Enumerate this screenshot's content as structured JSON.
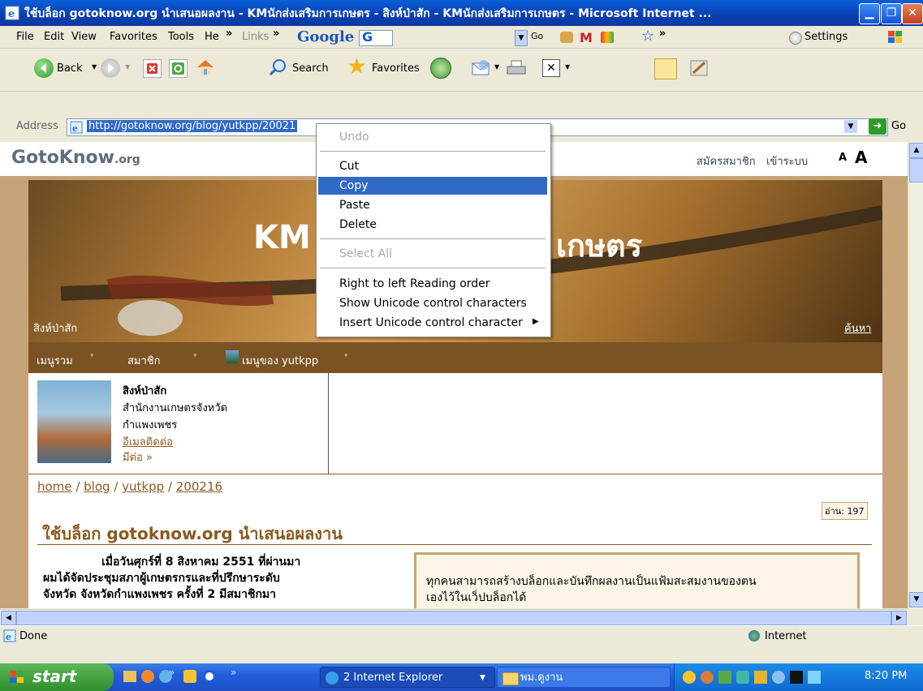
{
  "window": {
    "title": "ใช้บล็อก gotoknow.org นำเสนอผลงาน - KMนักส่งเสริมการเกษตร - สิงห์ป่าสัก - KMนักส่งเสริมการเกษตร - Microsoft Internet ...",
    "minimize": "▁",
    "maximize": "❐",
    "close": "✕"
  },
  "menubar": {
    "items": [
      "File",
      "Edit",
      "View",
      "Favorites",
      "Tools",
      "He"
    ],
    "more": "»",
    "links_label": "Links",
    "links_more": "»",
    "google_label": "Google",
    "google_g": "G",
    "go_label": "Go",
    "star_more": "»",
    "settings_label": "Settings"
  },
  "toolbar": {
    "back_label": "Back",
    "search_label": "Search",
    "favorites_label": "Favorites"
  },
  "address": {
    "label": "Address",
    "url": "http://gotoknow.org/blog/yutkpp/20021",
    "go_label": "Go"
  },
  "site": {
    "logo_main": "GotoKnow",
    "logo_suffix": ".org",
    "register_link": "สมัครสมาชิก",
    "login_link": "เข้าระบบ",
    "font_small": "A",
    "font_large": "A",
    "banner_title_left": "KM",
    "banner_title_right": "เกษตร",
    "banner_author": "สิงห์ป่าสัก",
    "banner_search": "ค้นหา",
    "nav": [
      "เมนูรวม",
      "สมาชิก",
      "เมนูของ yutkpp"
    ]
  },
  "profile": {
    "name": "สิงห์ป่าสัก",
    "org": "สำนักงานเกษตรจังหวัด",
    "province": "กำแพงเพชร",
    "email_link": "อีเมลติดต่อ",
    "more_link": "มีต่อ »"
  },
  "breadcrumb": {
    "items": [
      "home",
      "blog",
      "yutkpp",
      "200216"
    ],
    "separator": "/"
  },
  "post": {
    "read_count": "อ่าน: 197",
    "title": "ใช้บล็อก gotoknow.org นำเสนอผลงาน",
    "para_line1": "เมื่อวันศุกร์ที่ 8 สิงหาคม 2551 ที่ผ่านมา",
    "para_line2": "ผมได้จัดประชุมสภาผู้เกษตรกรและที่ปรึกษาระดับ",
    "para_line3": "จังหวัด จังหวัดกำแพงเพชร ครั้งที่ 2 มีสมาชิกมา",
    "quote_line1": "ทุกคนสามารถสร้างบล็อกและบันทึกผลงานเป็นแฟ้มสะสมงานของตน",
    "quote_line2": "เองไว้ในเว็ปบล็อกได้"
  },
  "context_menu": {
    "undo": "Undo",
    "cut": "Cut",
    "copy": "Copy",
    "paste": "Paste",
    "delete": "Delete",
    "select_all": "Select All",
    "rtl": "Right to left Reading order",
    "show_unicode": "Show Unicode control characters",
    "insert_unicode": "Insert Unicode control character"
  },
  "statusbar": {
    "status": "Done",
    "zone": "Internet"
  },
  "taskbar": {
    "start": "start",
    "tasks": [
      "2 Internet Explorer",
      "พม.ดูงาน"
    ],
    "clock": "8:20 PM"
  },
  "colors": {
    "banner_bg": "#b98a4c",
    "nav_bg": "#7a5224",
    "accent_brown": "#8b5a1e",
    "selection": "#316ac5"
  }
}
